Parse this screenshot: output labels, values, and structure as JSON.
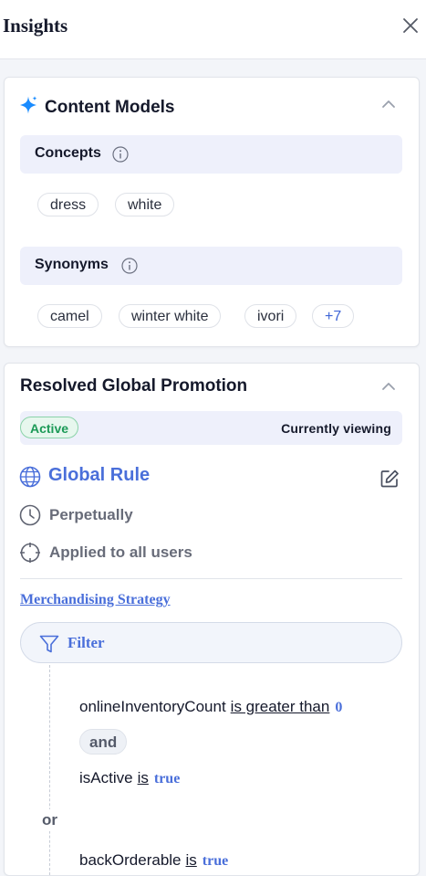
{
  "header": {
    "title": "Insights",
    "close_icon": "close-icon"
  },
  "content_models": {
    "title": "Content Models",
    "icon": "sparkle-icon",
    "accent": "#1a8cff",
    "concepts": {
      "label": "Concepts",
      "chips": [
        "dress",
        "white"
      ]
    },
    "synonyms": {
      "label": "Synonyms",
      "chips": [
        "camel",
        "winter white",
        "ivori"
      ],
      "more": "+7"
    }
  },
  "promotion": {
    "title": "Resolved Global Promotion",
    "status": "Active",
    "status_color": "#1c9a57",
    "currently_viewing": "Currently viewing",
    "rule_name": "Global Rule",
    "rule_color": "#4a6fda",
    "schedule": "Perpetually",
    "audience": "Applied to all users",
    "strategy_link": "Merchandising Strategy",
    "filter_label": "Filter",
    "conditions": [
      {
        "field": "onlineInventoryCount",
        "op": "is greater than",
        "value": "0"
      },
      {
        "field": "isActive",
        "op": "is",
        "value": "true"
      },
      {
        "field": "backOrderable",
        "op": "is",
        "value": "true"
      }
    ],
    "and_label": "and",
    "or_label": "or"
  }
}
